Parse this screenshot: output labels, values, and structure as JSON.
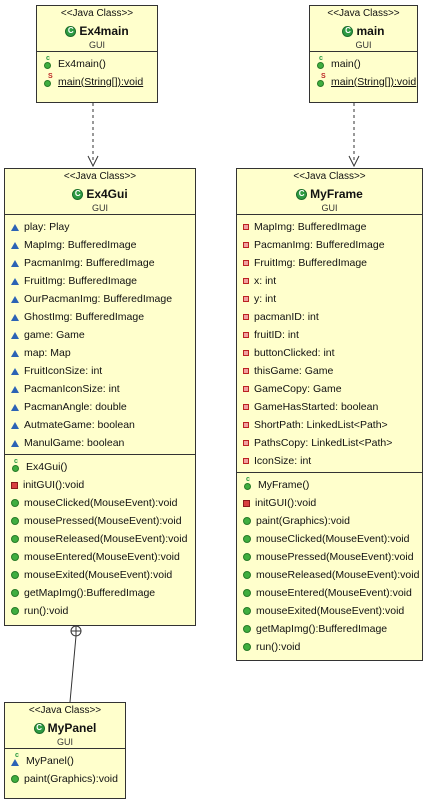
{
  "classes": {
    "ex4main": {
      "stereotype": "<<Java Class>>",
      "name": "Ex4main",
      "package": "GUI",
      "methods": [
        {
          "text": "Ex4main()",
          "kind": "constructor"
        },
        {
          "text": "main(String[]):void",
          "kind": "static"
        }
      ]
    },
    "main": {
      "stereotype": "<<Java Class>>",
      "name": "main",
      "package": "GUI",
      "methods": [
        {
          "text": "main()",
          "kind": "constructor"
        },
        {
          "text": "main(String[]):void",
          "kind": "static"
        }
      ]
    },
    "ex4gui": {
      "stereotype": "<<Java Class>>",
      "name": "Ex4Gui",
      "package": "GUI",
      "fields": [
        "play: Play",
        "MapImg: BufferedImage",
        "PacmanImg: BufferedImage",
        "FruitImg: BufferedImage",
        "OurPacmanImg: BufferedImage",
        "GhostImg: BufferedImage",
        "game: Game",
        "map: Map",
        "FruitIconSize: int",
        "PacmanIconSize: int",
        "PacmanAngle: double",
        "AutmateGame: boolean",
        "ManulGame: boolean"
      ],
      "methods": [
        {
          "text": "Ex4Gui()",
          "kind": "constructor"
        },
        {
          "text": "initGUI():void",
          "kind": "private"
        },
        {
          "text": "mouseClicked(MouseEvent):void",
          "kind": "public"
        },
        {
          "text": "mousePressed(MouseEvent):void",
          "kind": "public"
        },
        {
          "text": "mouseReleased(MouseEvent):void",
          "kind": "public"
        },
        {
          "text": "mouseEntered(MouseEvent):void",
          "kind": "public"
        },
        {
          "text": "mouseExited(MouseEvent):void",
          "kind": "public"
        },
        {
          "text": "getMapImg():BufferedImage",
          "kind": "public"
        },
        {
          "text": "run():void",
          "kind": "public"
        }
      ]
    },
    "myframe": {
      "stereotype": "<<Java Class>>",
      "name": "MyFrame",
      "package": "GUI",
      "fields": [
        "MapImg: BufferedImage",
        "PacmanImg: BufferedImage",
        "FruitImg: BufferedImage",
        "x: int",
        "y: int",
        "pacmanID: int",
        "fruitID: int",
        "buttonClicked: int",
        "thisGame: Game",
        "GameCopy: Game",
        "GameHasStarted: boolean",
        "ShortPath: LinkedList<Path>",
        "PathsCopy: LinkedList<Path>",
        "IconSize: int"
      ],
      "methods": [
        {
          "text": "MyFrame()",
          "kind": "constructor"
        },
        {
          "text": "initGUI():void",
          "kind": "private"
        },
        {
          "text": "paint(Graphics):void",
          "kind": "public"
        },
        {
          "text": "mouseClicked(MouseEvent):void",
          "kind": "public"
        },
        {
          "text": "mousePressed(MouseEvent):void",
          "kind": "public"
        },
        {
          "text": "mouseReleased(MouseEvent):void",
          "kind": "public"
        },
        {
          "text": "mouseEntered(MouseEvent):void",
          "kind": "public"
        },
        {
          "text": "mouseExited(MouseEvent):void",
          "kind": "public"
        },
        {
          "text": "getMapImg():BufferedImage",
          "kind": "public"
        },
        {
          "text": "run():void",
          "kind": "public"
        }
      ]
    },
    "mypanel": {
      "stereotype": "<<Java Class>>",
      "name": "MyPanel",
      "package": "GUI",
      "methods": [
        {
          "text": "MyPanel()",
          "kind": "constructor-package"
        },
        {
          "text": "paint(Graphics):void",
          "kind": "public"
        }
      ]
    }
  },
  "colors": {
    "class_fill": "#ffffcc",
    "border": "#333333",
    "class_icon": "#2e9b43"
  }
}
